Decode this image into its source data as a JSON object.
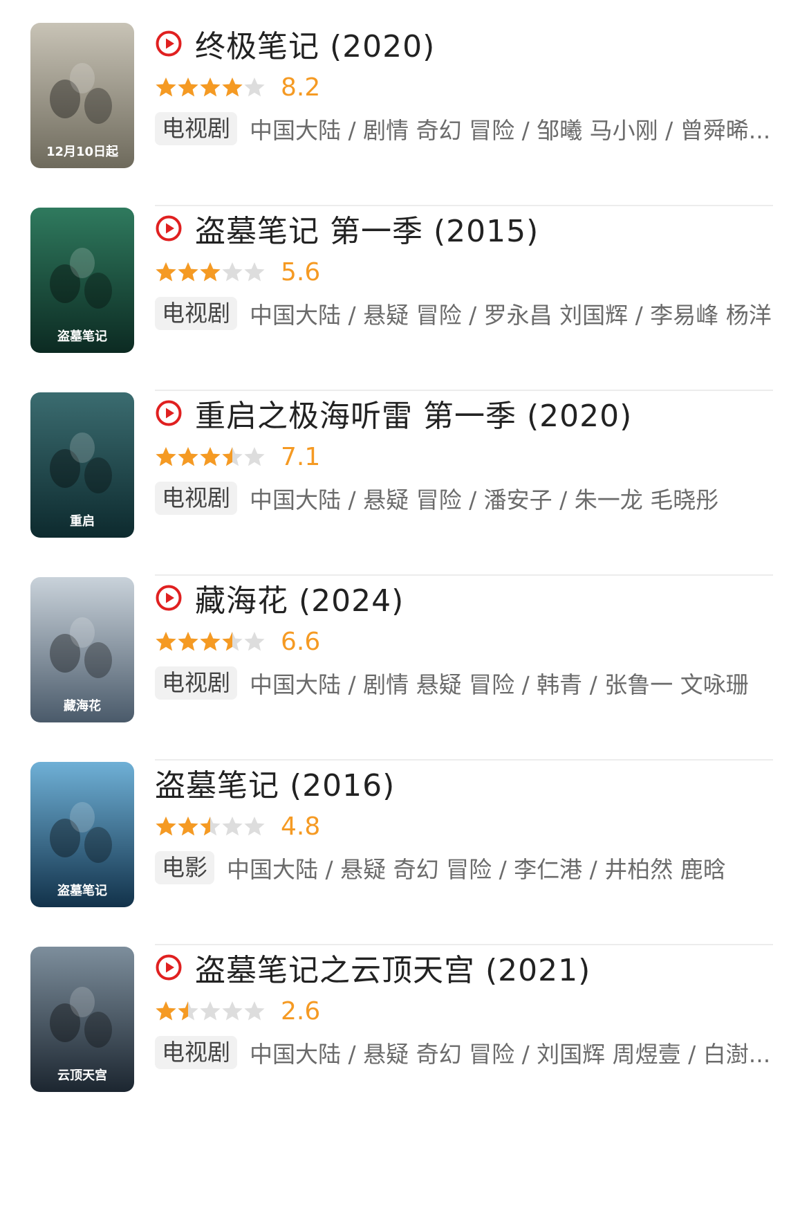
{
  "accent_play_color": "#e02020",
  "star_color": "#f59a23",
  "star_empty_color": "#dddddd",
  "items": [
    {
      "title": "终极笔记 (2020)",
      "has_play": true,
      "rating": 8.2,
      "score_text": "8.2",
      "stars": 4,
      "type": "电视剧",
      "meta": "中国大陆 / 剧情 奇幻 冒险 / 邹曦 马小刚 / 曾舜晞...",
      "poster_text": "12月10日起",
      "poster_colors": [
        "#6e6a5c",
        "#c8c3b6"
      ]
    },
    {
      "title": "盗墓笔记 第一季 (2015)",
      "has_play": true,
      "rating": 5.6,
      "score_text": "5.6",
      "stars": 3,
      "type": "电视剧",
      "meta": "中国大陆 / 悬疑 冒险 / 罗永昌 刘国辉 / 李易峰 杨洋",
      "poster_text": "盗墓笔记",
      "poster_colors": [
        "#0c2a22",
        "#2f7a5e"
      ]
    },
    {
      "title": "重启之极海听雷 第一季 (2020)",
      "has_play": true,
      "rating": 7.1,
      "score_text": "7.1",
      "stars": 3.5,
      "type": "电视剧",
      "meta": "中国大陆 / 悬疑 冒险 / 潘安子 / 朱一龙 毛晓彤",
      "poster_text": "重启",
      "poster_colors": [
        "#0d2a2e",
        "#3b6c70"
      ]
    },
    {
      "title": "藏海花 (2024)",
      "has_play": true,
      "rating": 6.6,
      "score_text": "6.6",
      "stars": 3.5,
      "type": "电视剧",
      "meta": "中国大陆 / 剧情 悬疑 冒险 / 韩青 / 张鲁一 文咏珊",
      "poster_text": "藏海花",
      "poster_colors": [
        "#4a5a6a",
        "#c9d2da"
      ]
    },
    {
      "title": "盗墓笔记 (2016)",
      "has_play": false,
      "rating": 4.8,
      "score_text": "4.8",
      "stars": 2.5,
      "type": "电影",
      "meta": "中国大陆 / 悬疑 奇幻 冒险 / 李仁港 / 井柏然 鹿晗",
      "poster_text": "盗墓笔记",
      "poster_colors": [
        "#12324a",
        "#6fb0d6"
      ]
    },
    {
      "title": "盗墓笔记之云顶天宫 (2021)",
      "has_play": true,
      "rating": 2.6,
      "score_text": "2.6",
      "stars": 1.5,
      "type": "电视剧",
      "meta": "中国大陆 / 悬疑 奇幻 冒险 / 刘国辉 周煜壹 / 白澍...",
      "poster_text": "云顶天宫",
      "poster_colors": [
        "#1c2630",
        "#7d8e9c"
      ]
    }
  ]
}
